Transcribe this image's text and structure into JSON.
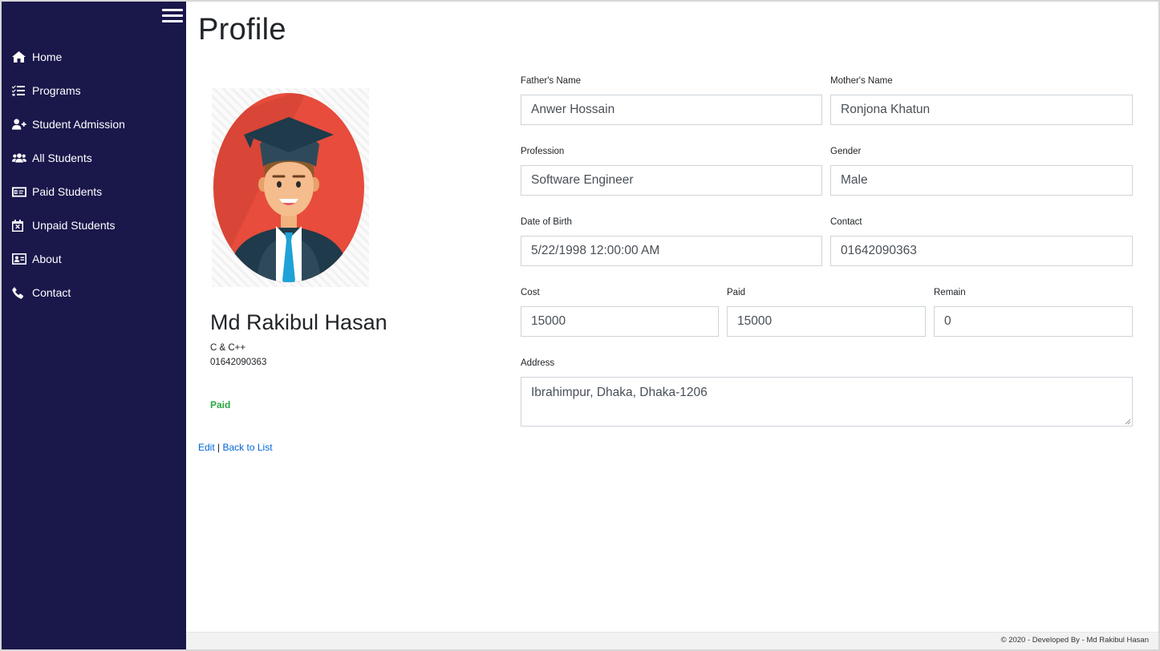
{
  "sidebar": {
    "items": [
      {
        "label": "Home",
        "icon": "home-icon"
      },
      {
        "label": "Programs",
        "icon": "tasks-icon"
      },
      {
        "label": "Student Admission",
        "icon": "user-plus-icon"
      },
      {
        "label": "All Students",
        "icon": "users-icon"
      },
      {
        "label": "Paid Students",
        "icon": "money-check-icon"
      },
      {
        "label": "Unpaid Students",
        "icon": "calendar-times-icon"
      },
      {
        "label": "About",
        "icon": "id-card-icon"
      },
      {
        "label": "Contact",
        "icon": "phone-icon"
      }
    ]
  },
  "page": {
    "title": "Profile"
  },
  "profile": {
    "name": "Md Rakibul Hasan",
    "program": "C & C++",
    "phone": "01642090363",
    "status": "Paid"
  },
  "links": {
    "edit": "Edit",
    "separator": "|",
    "back": "Back to List"
  },
  "form": {
    "fathers_name": {
      "label": "Father's Name",
      "value": "Anwer Hossain"
    },
    "mothers_name": {
      "label": "Mother's Name",
      "value": "Ronjona Khatun"
    },
    "profession": {
      "label": "Profession",
      "value": "Software Engineer"
    },
    "gender": {
      "label": "Gender",
      "value": "Male"
    },
    "dob": {
      "label": "Date of Birth",
      "value": "5/22/1998 12:00:00 AM"
    },
    "contact": {
      "label": "Contact",
      "value": "01642090363"
    },
    "cost": {
      "label": "Cost",
      "value": "15000"
    },
    "paid": {
      "label": "Paid",
      "value": "15000"
    },
    "remain": {
      "label": "Remain",
      "value": "0"
    },
    "address": {
      "label": "Address",
      "value": "Ibrahimpur, Dhaka, Dhaka-1206"
    }
  },
  "footer": {
    "text": "© 2020 - Developed By - Md Rakibul Hasan"
  },
  "colors": {
    "sidebar_bg": "#1a174b",
    "link": "#0366d6",
    "status_paid": "#28a745",
    "avatar_bg": "#e74c3c"
  }
}
